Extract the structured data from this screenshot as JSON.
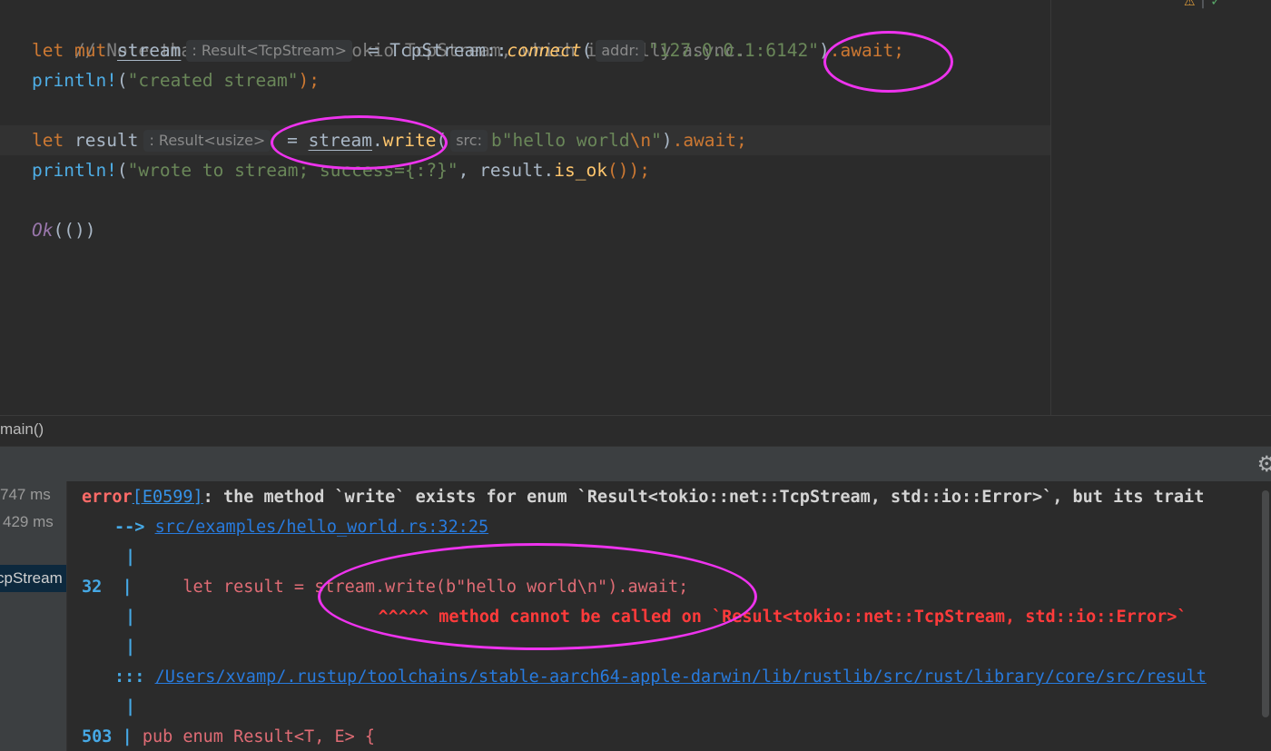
{
  "editor": {
    "lines": {
      "l1": {
        "comment": "// Note that this is the Tokio TcpStream, which is fully async."
      },
      "l2": {
        "let": "let",
        "mut": "mut",
        "var": "stream",
        "hint": ": Result<TcpStream>",
        "eq": "= TcpStream::",
        "fn": "connect",
        "open": "(",
        "param_hint": "addr:",
        "str": "\"127.0.0.1:6142\"",
        "close": ")",
        "await": ".await;"
      },
      "l3": {
        "macro": "println!",
        "open": "(",
        "str": "\"created stream\"",
        "close": ");"
      },
      "l4": {
        "let": "let",
        "var": "result",
        "hint": ": Result<usize>",
        "eq": "= ",
        "recv": "stream",
        "dot": ".",
        "method": "write",
        "open": "(",
        "param_hint": "src:",
        "str": "b\"hello world",
        "esc": "\\n",
        "str_end": "\"",
        "close": ")",
        "await": ".await;"
      },
      "l5": {
        "macro": "println!",
        "open": "(",
        "str": "\"wrote to stream; success={:?}\"",
        "rest": ", result.",
        "method": "is_ok",
        "close": "());"
      },
      "l6": {
        "enum": "Ok",
        "rest": "(())"
      }
    },
    "status_icons": {
      "warning": "⚠",
      "ok": "✓"
    }
  },
  "breadcrumb": {
    "item": "main()"
  },
  "run_panel": {
    "tree": {
      "time1": "747 ms",
      "time2": "429 ms",
      "selected": "cpStream"
    },
    "console": {
      "error_word": "error",
      "error_code": "[E0599]",
      "error_msg": ": the method `write` exists for enum `Result<tokio::net::TcpStream, std::io::Error>`, but its trait",
      "arrow": "-->",
      "location": "src/examples/hello_world.rs:32:25",
      "pipe": "|",
      "line_no": "32",
      "code": "let result = stream.write(b\"hello world\\n\").await;",
      "carets": "^^^^^ method cannot be called on `Result<tokio::net::TcpStream, std::io::Error>`",
      "colons": ":::",
      "lib_path": "/Users/xvamp/.rustup/toolchains/stable-aarch64-apple-darwin/lib/rustlib/src/rust/library/core/src/result",
      "line_no2": "503",
      "code2": "pub enum Result<T, E> {"
    }
  },
  "colors": {
    "annotation": "#ee33ee",
    "keyword": "#cc7832",
    "string": "#6a8759",
    "error": "#ff6b68",
    "link": "#287bde"
  }
}
